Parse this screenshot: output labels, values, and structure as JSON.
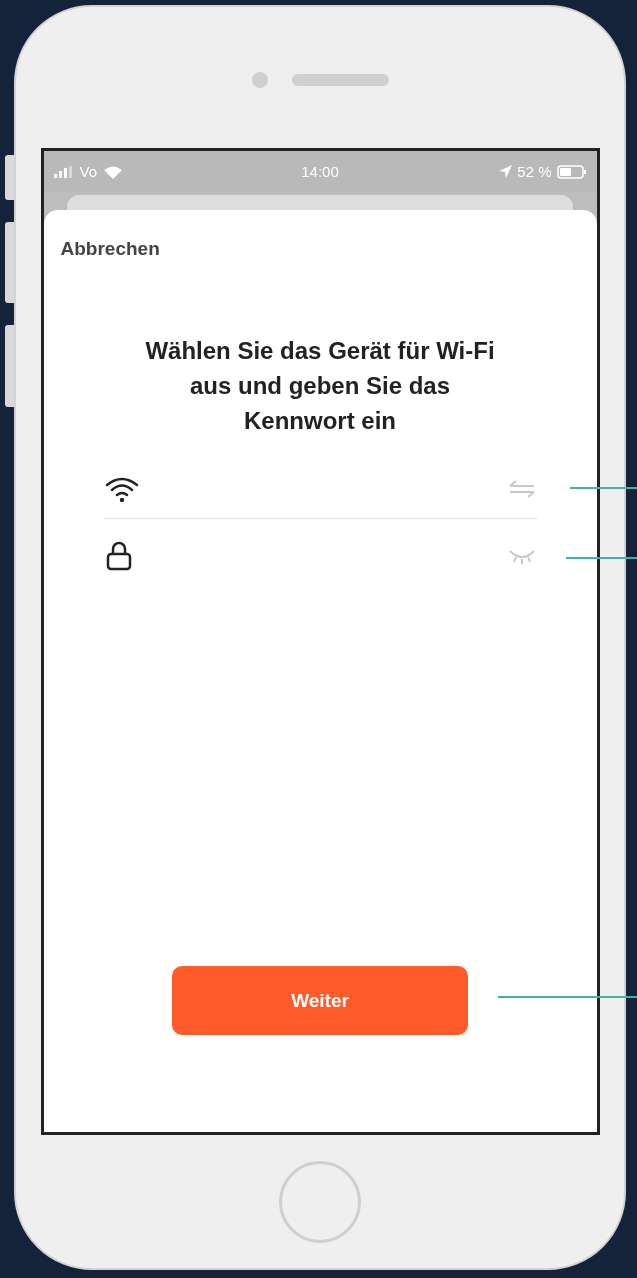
{
  "status_bar": {
    "carrier": "Vo",
    "time": "14:00",
    "battery": "52 %"
  },
  "cancel": "Abbrechen",
  "title": "Wählen Sie das Gerät für Wi-Fi\naus und geben Sie das\nKennwort ein",
  "fields": [
    {
      "kind": "wifi"
    },
    {
      "kind": "password"
    }
  ],
  "button": "Weiter"
}
